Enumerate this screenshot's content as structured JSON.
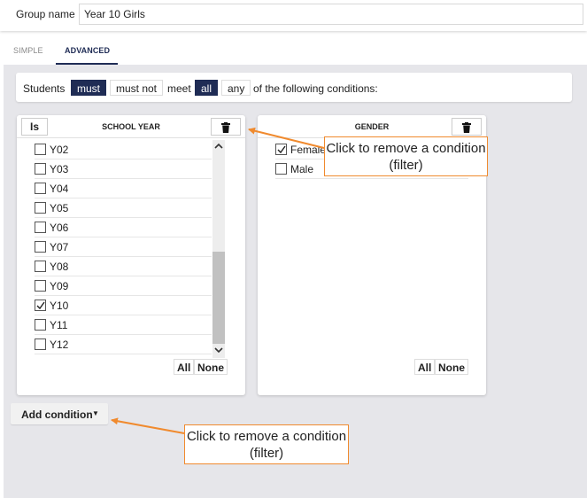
{
  "group": {
    "label": "Group name",
    "value": "Year 10 Girls"
  },
  "tabs": [
    {
      "label": "SIMPLE",
      "active": false
    },
    {
      "label": "ADVANCED",
      "active": true
    }
  ],
  "condition_bar": {
    "subject": "Students",
    "must": "must",
    "must_not": "must not",
    "meet": "meet",
    "all": "all",
    "any": "any",
    "suffix": "of the following conditions:"
  },
  "school_year_panel": {
    "operator": "Is",
    "title": "SCHOOL YEAR",
    "items": [
      {
        "label": "Y02",
        "checked": false
      },
      {
        "label": "Y03",
        "checked": false
      },
      {
        "label": "Y04",
        "checked": false
      },
      {
        "label": "Y05",
        "checked": false
      },
      {
        "label": "Y06",
        "checked": false
      },
      {
        "label": "Y07",
        "checked": false
      },
      {
        "label": "Y08",
        "checked": false
      },
      {
        "label": "Y09",
        "checked": false
      },
      {
        "label": "Y10",
        "checked": true
      },
      {
        "label": "Y11",
        "checked": false
      },
      {
        "label": "Y12",
        "checked": false
      }
    ],
    "all_label": "All",
    "none_label": "None"
  },
  "gender_panel": {
    "title": "GENDER",
    "items": [
      {
        "label": "Female",
        "checked": true
      },
      {
        "label": "Male",
        "checked": false
      }
    ],
    "all_label": "All",
    "none_label": "None"
  },
  "add_condition": {
    "label": "Add condition",
    "caret": "▼"
  },
  "callouts": {
    "delete_filter": "Click to remove a condition (filter)",
    "add_condition": "Click to remove a condition (filter)"
  },
  "colors": {
    "accent": "#1f2c55",
    "callout_border": "#f08a2e",
    "background": "#e6e6ea"
  },
  "icons": {
    "trash": "trash-icon",
    "check": "check-icon",
    "scroll_up": "chevron-up-icon",
    "scroll_down": "chevron-down-icon",
    "caret": "caret-down-icon"
  }
}
